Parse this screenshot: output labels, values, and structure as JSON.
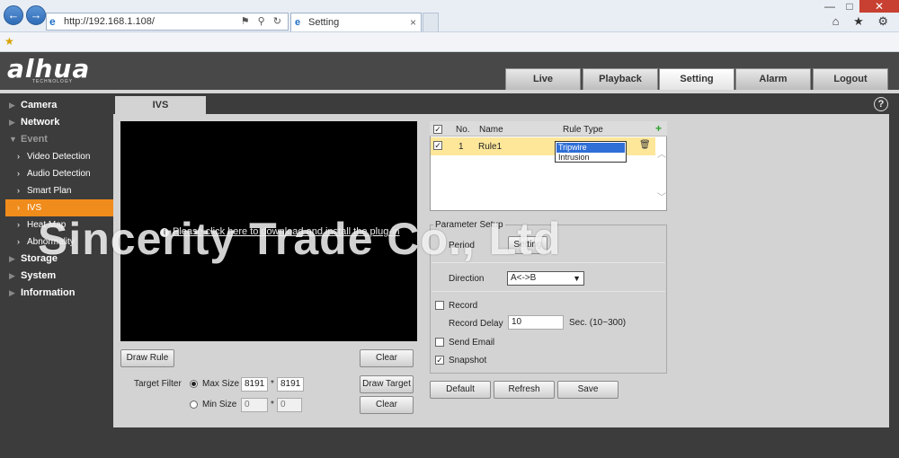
{
  "browser": {
    "url": "http://192.168.1.108/",
    "tab_title": "Setting",
    "tab_close": "×",
    "window_controls": [
      "—",
      "□",
      "✕"
    ],
    "right_icons": "⌂ ★ ⚙"
  },
  "app": {
    "logo": "alhua",
    "logo_sub": "TECHNOLOGY",
    "main_tabs": [
      "Live",
      "Playback",
      "Setting",
      "Alarm",
      "Logout"
    ],
    "active_tab": "Setting"
  },
  "sidebar": {
    "items": [
      {
        "label": "Camera"
      },
      {
        "label": "Network"
      },
      {
        "label": "Event"
      },
      {
        "label": "Video Detection"
      },
      {
        "label": "Audio Detection"
      },
      {
        "label": "Smart Plan"
      },
      {
        "label": "IVS"
      },
      {
        "label": "Heat Map"
      },
      {
        "label": "Abnormality"
      },
      {
        "label": "Storage"
      },
      {
        "label": "System"
      },
      {
        "label": "Information"
      }
    ]
  },
  "page": {
    "tab": "IVS",
    "help": "?",
    "plugin_text": "Please click here to download and install the plug-in",
    "draw_rule": "Draw Rule",
    "clear": "Clear",
    "draw_target": "Draw Target",
    "clear2": "Clear",
    "target_filter": "Target Filter",
    "max_size_label": "Max Size",
    "min_size_label": "Min Size",
    "max_w": "8191",
    "max_h": "8191",
    "min_w": "0",
    "min_h": "0",
    "times": "*"
  },
  "rules": {
    "headers": {
      "no": "No.",
      "name": "Name",
      "type": "Rule Type"
    },
    "rows": [
      {
        "no": "1",
        "name": "Rule1"
      }
    ],
    "options": [
      "Tripwire",
      "Intrusion"
    ],
    "selected": "Tripwire"
  },
  "params": {
    "title": "Parameter Setup",
    "period_label": "Period",
    "setting": "Setting",
    "direction_label": "Direction",
    "direction_value": "A<->B",
    "record": "Record",
    "record_delay": "Record Delay",
    "record_delay_value": "10",
    "record_delay_unit": "Sec. (10~300)",
    "send_email": "Send Email",
    "snapshot": "Snapshot"
  },
  "actions": {
    "default": "Default",
    "refresh": "Refresh",
    "save": "Save"
  },
  "watermark": "Sincerity Trade Co., Ltd"
}
